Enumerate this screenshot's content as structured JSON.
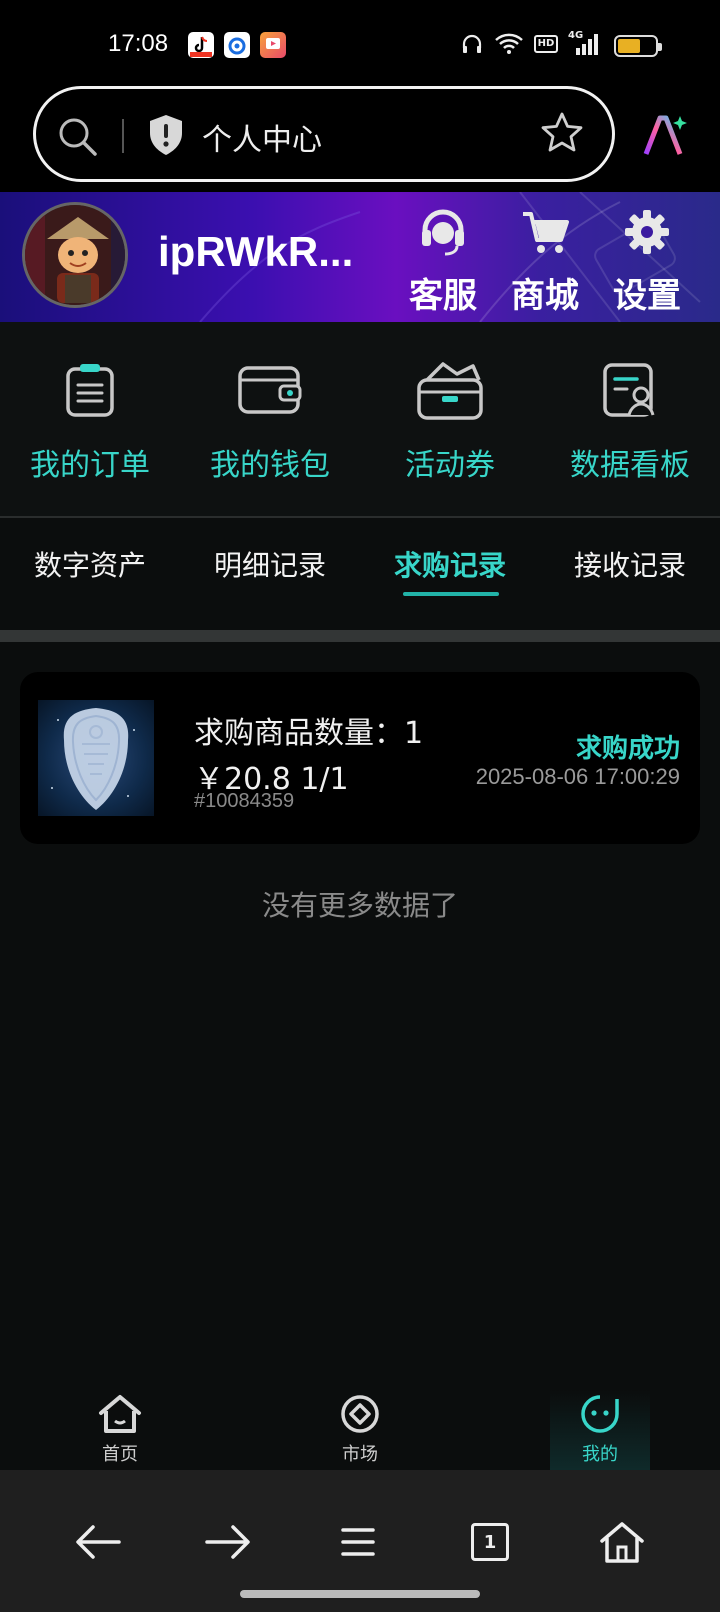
{
  "status_bar": {
    "time": "17:08",
    "notification_icons": [
      "tiktok-icon",
      "app-blue-icon",
      "app-video-icon"
    ],
    "system_icons": [
      "headphones-icon",
      "wifi-icon",
      "hd-icon",
      "signal-4g-icon",
      "battery-icon"
    ],
    "network": "4G",
    "hd_label": "HD"
  },
  "browser": {
    "address_title": "个人中心",
    "ai_button": "ai-assistant-icon"
  },
  "profile": {
    "username": "ipRWkR...",
    "actions": [
      {
        "label": "客服",
        "icon": "headset-icon"
      },
      {
        "label": "商城",
        "icon": "cart-icon"
      },
      {
        "label": "设置",
        "icon": "gear-icon"
      }
    ]
  },
  "quick_actions": [
    {
      "label": "我的订单",
      "icon": "clipboard-icon"
    },
    {
      "label": "我的钱包",
      "icon": "wallet-icon"
    },
    {
      "label": "活动券",
      "icon": "coupon-icon"
    },
    {
      "label": "数据看板",
      "icon": "data-board-icon"
    }
  ],
  "tabs": {
    "items": [
      "数字资产",
      "明细记录",
      "求购记录",
      "接收记录"
    ],
    "active_index": 2
  },
  "records": [
    {
      "quantity_label": "求购商品数量：",
      "quantity": "1",
      "price": "￥20.8 1/1",
      "code": "#10084359",
      "status": "求购成功",
      "datetime": "2025-08-06 17:00:29"
    }
  ],
  "no_more_text": "没有更多数据了",
  "app_nav": [
    {
      "label": "首页",
      "icon": "home-icon"
    },
    {
      "label": "市场",
      "icon": "market-icon"
    },
    {
      "label": "我的",
      "icon": "profile-face-icon",
      "active": true
    }
  ],
  "browser_toolbar": {
    "tab_count": "1",
    "buttons": [
      "back-arrow-icon",
      "forward-arrow-icon",
      "menu-icon",
      "tabs-icon",
      "home-icon"
    ]
  },
  "colors": {
    "accent": "#38d6c9",
    "background": "#0b0d0d",
    "header_gradient_start": "#1a0f7a",
    "header_gradient_mid": "#6a0fc0",
    "battery": "#e8b023"
  }
}
